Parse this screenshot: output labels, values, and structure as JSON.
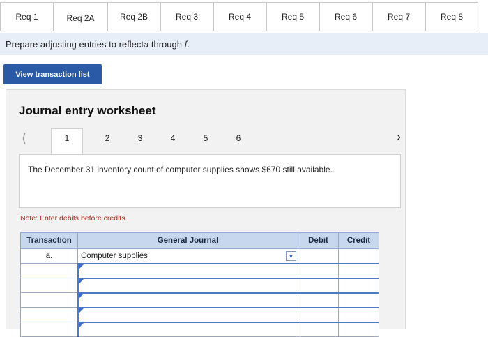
{
  "tabs": [
    {
      "label": "Req 1",
      "active": false
    },
    {
      "label": "Req 2A",
      "active": true
    },
    {
      "label": "Req 2B",
      "active": false
    },
    {
      "label": "Req 3",
      "active": false
    },
    {
      "label": "Req 4",
      "active": false
    },
    {
      "label": "Req 5",
      "active": false
    },
    {
      "label": "Req 6",
      "active": false
    },
    {
      "label": "Req 7",
      "active": false
    },
    {
      "label": "Req 8",
      "active": false
    }
  ],
  "instruction": {
    "prefix": "Prepare adjusting entries to reflect ",
    "a": "a",
    "middle": " through ",
    "f": "f",
    "suffix": "."
  },
  "view_button": "View transaction list",
  "worksheet": {
    "title": "Journal entry worksheet",
    "prev_icon": "chevron-left",
    "next_icon": "chevron-right",
    "pages": [
      "1",
      "2",
      "3",
      "4",
      "5",
      "6"
    ],
    "active_page": "1",
    "description": "The December 31 inventory count of computer supplies shows $670 still available.",
    "note": "Note: Enter debits before credits."
  },
  "journal": {
    "headers": {
      "transaction": "Transaction",
      "general_journal": "General Journal",
      "debit": "Debit",
      "credit": "Credit"
    },
    "rows": [
      {
        "transaction": "a.",
        "account": "Computer supplies",
        "debit": "",
        "credit": ""
      },
      {
        "transaction": "",
        "account": "",
        "debit": "",
        "credit": ""
      },
      {
        "transaction": "",
        "account": "",
        "debit": "",
        "credit": ""
      },
      {
        "transaction": "",
        "account": "",
        "debit": "",
        "credit": ""
      },
      {
        "transaction": "",
        "account": "",
        "debit": "",
        "credit": ""
      },
      {
        "transaction": "",
        "account": "",
        "debit": "",
        "credit": ""
      }
    ]
  },
  "colors": {
    "accent": "#2a5aa6",
    "header_bg": "#c7d7ee",
    "instruction_bg": "#e7eef8",
    "note_red": "#b3261e"
  }
}
